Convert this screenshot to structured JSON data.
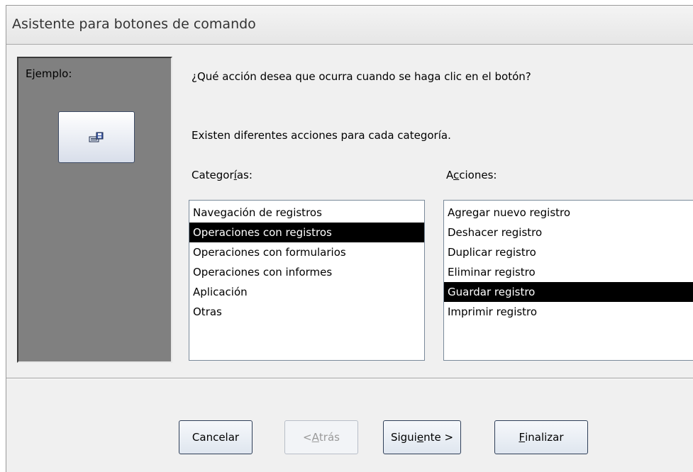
{
  "window": {
    "title": "Asistente para botones de comando"
  },
  "preview": {
    "label": "Ejemplo:",
    "icon": "save-record-icon"
  },
  "question": "¿Qué acción desea que ocurra cuando se haga clic en el botón?",
  "info": "Existen diferentes acciones para cada categoría.",
  "categories": {
    "label_pre": "Categor",
    "label_key": "í",
    "label_post": "as:",
    "items": [
      "Navegación de registros",
      "Operaciones con registros",
      "Operaciones con formularios",
      "Operaciones con informes",
      "Aplicación",
      "Otras"
    ],
    "selected": "Operaciones con registros"
  },
  "actions": {
    "label_pre": "A",
    "label_key": "c",
    "label_post": "ciones:",
    "items": [
      "Agregar nuevo registro",
      "Deshacer registro",
      "Duplicar registro",
      "Eliminar registro",
      "Guardar registro",
      "Imprimir registro"
    ],
    "selected": "Guardar registro"
  },
  "buttons": {
    "cancel": "Cancelar",
    "back_pre": "< ",
    "back_key": "A",
    "back_post": "trás",
    "next_pre": "Sigui",
    "next_key": "e",
    "next_post": "nte >",
    "finish_key": "F",
    "finish_post": "inalizar"
  },
  "colors": {
    "selection_bg": "#000000",
    "preview_bg": "#808080",
    "dialog_bg": "#f0f0f0"
  }
}
